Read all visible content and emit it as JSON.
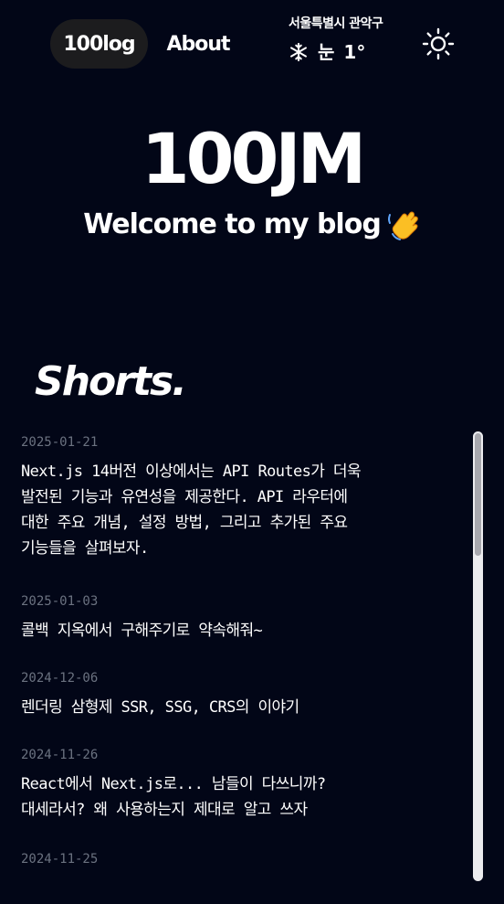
{
  "nav": {
    "home_label": "100log",
    "about_label": "About"
  },
  "weather": {
    "location": "서울특별시 관악구",
    "icon": "snowflake-icon",
    "condition": "눈",
    "temperature": "1°"
  },
  "theme_toggle": {
    "icon": "sun-icon"
  },
  "hero": {
    "title": "100JM",
    "subtitle": "Welcome to my blog",
    "emoji_icon": "waving-hand-icon"
  },
  "shorts": {
    "heading": "Shorts.",
    "items": [
      {
        "date": "2025-01-21",
        "text": "Next.js 14버전 이상에서는 API Routes가 더욱\n발전된 기능과 유연성을 제공한다. API 라우터에\n대한 주요 개념, 설정 방법, 그리고 추가된 주요\n기능들을 살펴보자."
      },
      {
        "date": "2025-01-03",
        "text": "콜백 지옥에서 구해주기로 약속해줘~"
      },
      {
        "date": "2024-12-06",
        "text": "렌더링 삼형제 SSR, SSG, CRS의 이야기"
      },
      {
        "date": "2024-11-26",
        "text": "React에서 Next.js로... 남들이 다쓰니까?\n대세라서? 왜 사용하는지 제대로 알고 쓰자"
      },
      {
        "date": "2024-11-25",
        "text": ""
      }
    ]
  },
  "colors": {
    "background": "#020617",
    "pill": "#1c1c1e",
    "date": "#6b7280",
    "wave_hand": "#fbbf24"
  },
  "scroll_position": 0
}
